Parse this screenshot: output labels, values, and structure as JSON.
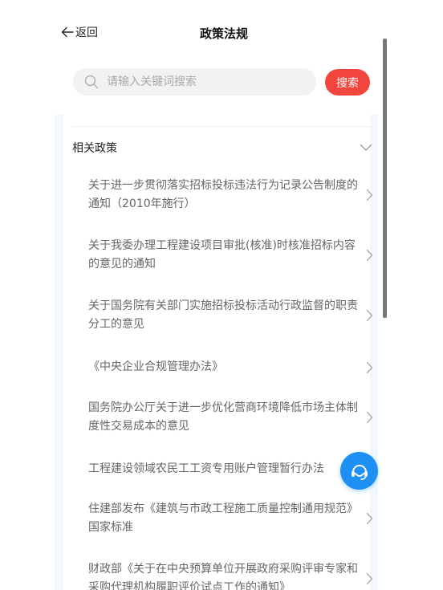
{
  "header": {
    "back_label": "返回",
    "title": "政策法规"
  },
  "search": {
    "placeholder": "请输入关键词搜索",
    "value": "",
    "button_label": "搜索"
  },
  "section": {
    "title": "相关政策",
    "expanded": true
  },
  "items": [
    {
      "title": "关于进一步贯彻落实招标投标违法行为记录公告制度的通知（2010年施行）"
    },
    {
      "title": "关于我委办理工程建设项目审批(核准)时核准招标内容的意见的通知"
    },
    {
      "title": "关于国务院有关部门实施招标投标活动行政监督的职责分工的意见"
    },
    {
      "title": "《中央企业合规管理办法》"
    },
    {
      "title": "国务院办公厅关于进一步优化营商环境降低市场主体制度性交易成本的意见"
    },
    {
      "title": "工程建设领域农民工工资专用账户管理暂行办法"
    },
    {
      "title": "住建部发布《建筑与市政工程施工质量控制通用规范》国家标准"
    },
    {
      "title": "财政部《关于在中央预算单位开展政府采购评审专家和采购代理机构履职评价试点工作的通知》"
    }
  ],
  "colors": {
    "accent": "#f2453d",
    "fab": "#1e8ff3",
    "panel_bg": "#f3f8fd"
  },
  "icons": {
    "back": "arrow-left-icon",
    "search": "search-icon",
    "section_toggle": "chevron-down-icon",
    "item": "chevron-right-icon",
    "fab": "customer-service-icon"
  }
}
